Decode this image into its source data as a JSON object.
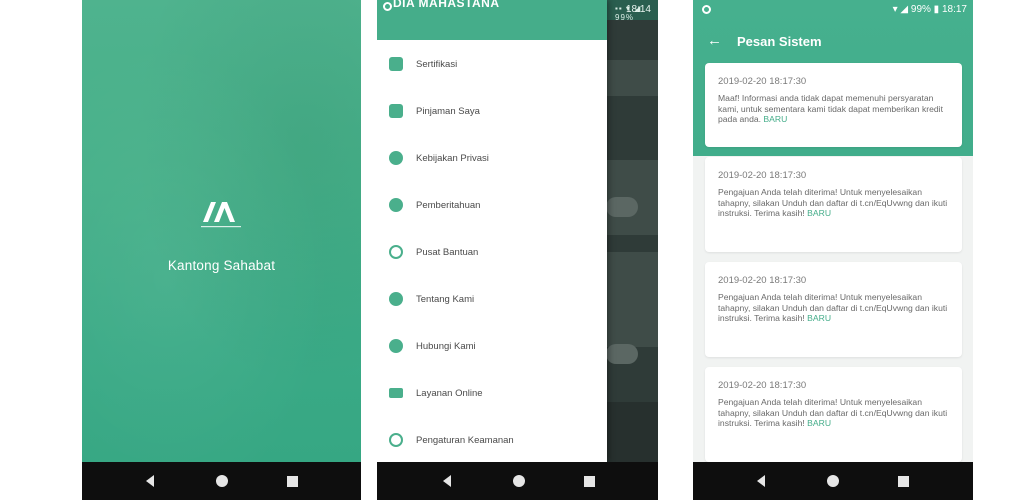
{
  "splash": {
    "logo_icon": "kantong-sahabat-logo",
    "app_name": "Kantong Sahabat",
    "brand_color": "#46b089"
  },
  "drawer_screen": {
    "header_title": "DIA MAHASTANA",
    "status_time": "18:14",
    "status_icons": "▪▪ ▾ ◢ 99%",
    "menu": [
      {
        "label": "Sertifikasi",
        "icon": "certificate-icon"
      },
      {
        "label": "Pinjaman Saya",
        "icon": "loan-icon"
      },
      {
        "label": "Kebijakan Privasi",
        "icon": "privacy-icon"
      },
      {
        "label": "Pemberitahuan",
        "icon": "notification-icon"
      },
      {
        "label": "Pusat Bantuan",
        "icon": "help-icon"
      },
      {
        "label": "Tentang Kami",
        "icon": "about-icon"
      },
      {
        "label": "Hubungi Kami",
        "icon": "contact-icon"
      },
      {
        "label": "Layanan Online",
        "icon": "chat-icon"
      },
      {
        "label": "Pengaturan Keamanan",
        "icon": "security-icon"
      }
    ]
  },
  "messages_screen": {
    "status_text": "▾ ◢ 99% ▮ 18:17",
    "title": "Pesan Sistem",
    "cards": [
      {
        "date": "2019-02-20 18:17:30",
        "text": "Maaf! Informasi anda tidak dapat memenuhi persyaratan kami, untuk sementara kami tidak dapat memberikan kredit pada anda.",
        "badge": "BARU"
      },
      {
        "date": "2019-02-20 18:17:30",
        "text": "Pengajuan Anda telah diterima! Untuk menyelesaikan tahapny, silakan Unduh dan daftar di t.cn/EqUvwng dan ikuti instruksi. Terima kasih!",
        "badge": "BARU"
      },
      {
        "date": "2019-02-20 18:17:30",
        "text": "Pengajuan Anda telah diterima! Untuk menyelesaikan tahapny, silakan Unduh dan daftar di t.cn/EqUvwng dan ikuti instruksi. Terima kasih!",
        "badge": "BARU"
      },
      {
        "date": "2019-02-20 18:17:30",
        "text": "Pengajuan Anda telah diterima! Untuk menyelesaikan tahapny, silakan Unduh dan daftar di t.cn/EqUvwng dan ikuti instruksi. Terima kasih!",
        "badge": "BARU"
      }
    ]
  },
  "navbar": {
    "back_icon": "back-triangle-icon",
    "home_icon": "home-circle-icon",
    "recent_icon": "recent-square-icon"
  }
}
